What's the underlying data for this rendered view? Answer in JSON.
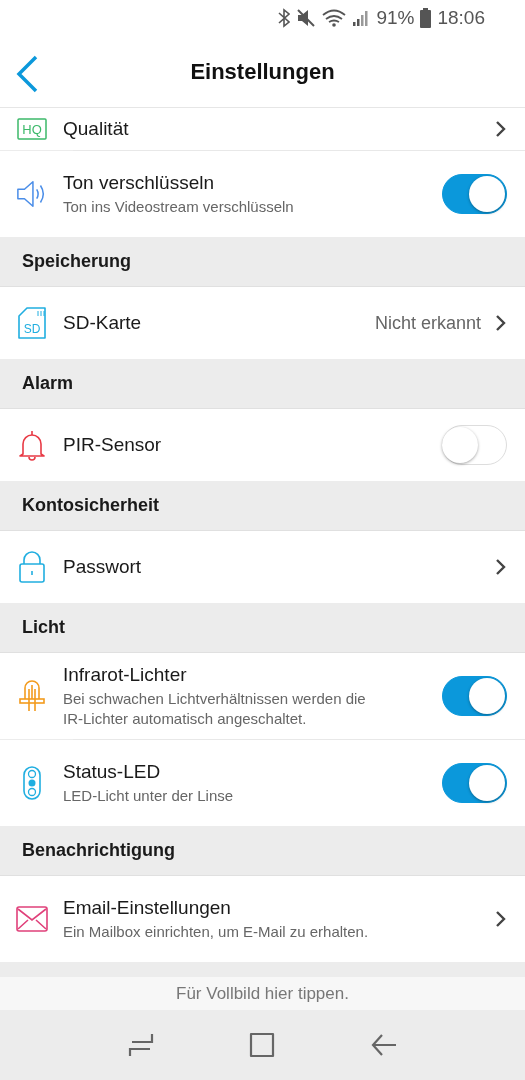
{
  "status_bar": {
    "battery": "91%",
    "time": "18:06"
  },
  "header": {
    "title": "Einstellungen"
  },
  "sections": [
    {
      "items": [
        {
          "kind": "link",
          "icon_text": "HQ",
          "label": "Qualität"
        },
        {
          "kind": "toggle",
          "label": "Ton verschlüsseln",
          "description": "Ton ins Videostream verschlüsseln",
          "on": true
        }
      ]
    },
    {
      "title": "Speicherung",
      "items": [
        {
          "kind": "link",
          "icon_text": "SD",
          "label": "SD-Karte",
          "value": "Nicht erkannt"
        }
      ]
    },
    {
      "title": "Alarm",
      "items": [
        {
          "kind": "toggle",
          "label": "PIR-Sensor",
          "on": false
        }
      ]
    },
    {
      "title": "Kontosicherheit",
      "items": [
        {
          "kind": "link",
          "label": "Passwort"
        }
      ]
    },
    {
      "title": "Licht",
      "items": [
        {
          "kind": "toggle",
          "label": "Infrarot-Lichter",
          "description": "Bei schwachen Lichtverhältnissen werden die IR-Lichter automatisch angeschaltet.",
          "on": true
        },
        {
          "kind": "toggle",
          "label": "Status-LED",
          "description": "LED-Licht unter der Linse",
          "on": true
        }
      ]
    },
    {
      "title": "Benachrichtigung",
      "items": [
        {
          "kind": "link",
          "label": "Email-Einstellungen",
          "description": "Ein Mailbox einrichten, um E-Mail zu erhalten."
        }
      ]
    }
  ],
  "footer_hint": "Für Vollbild hier tippen."
}
